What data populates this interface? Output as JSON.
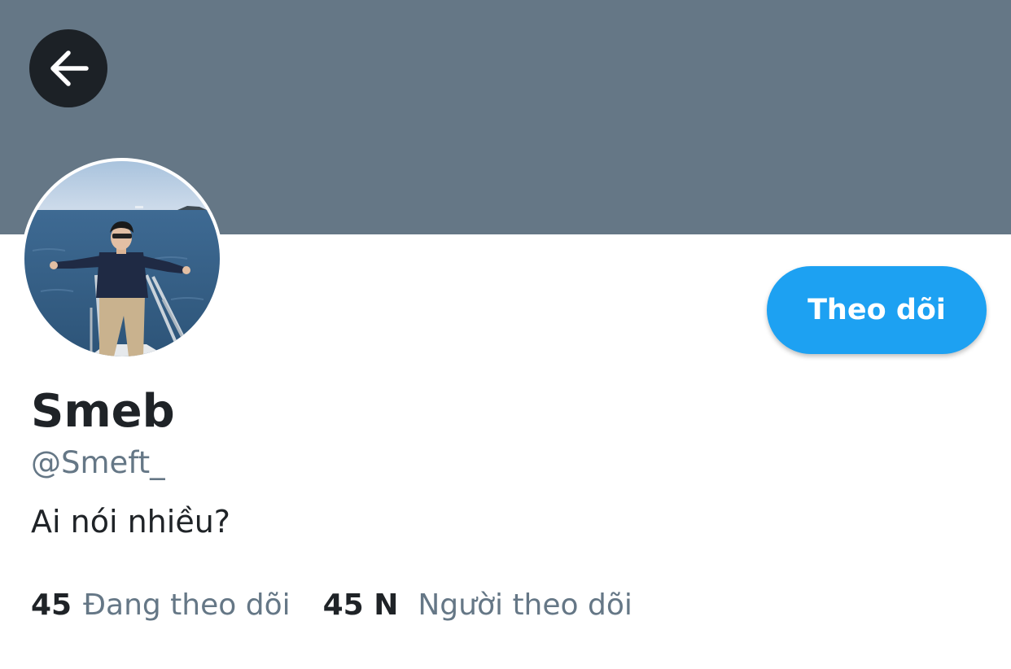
{
  "header": {
    "banner_color": "#657786",
    "back_icon": "arrow-left-icon"
  },
  "profile": {
    "avatar_icon": "profile-photo",
    "display_name": "Smeb",
    "handle": "@Smeft_",
    "bio": "Ai nói nhiều?",
    "follow_label": "Theo dõi",
    "accent_color": "#1da1f2"
  },
  "stats": {
    "following_count": "45",
    "following_label": "Đang theo dõi",
    "followers_count": "45 N",
    "followers_label": "Người theo dõi"
  }
}
